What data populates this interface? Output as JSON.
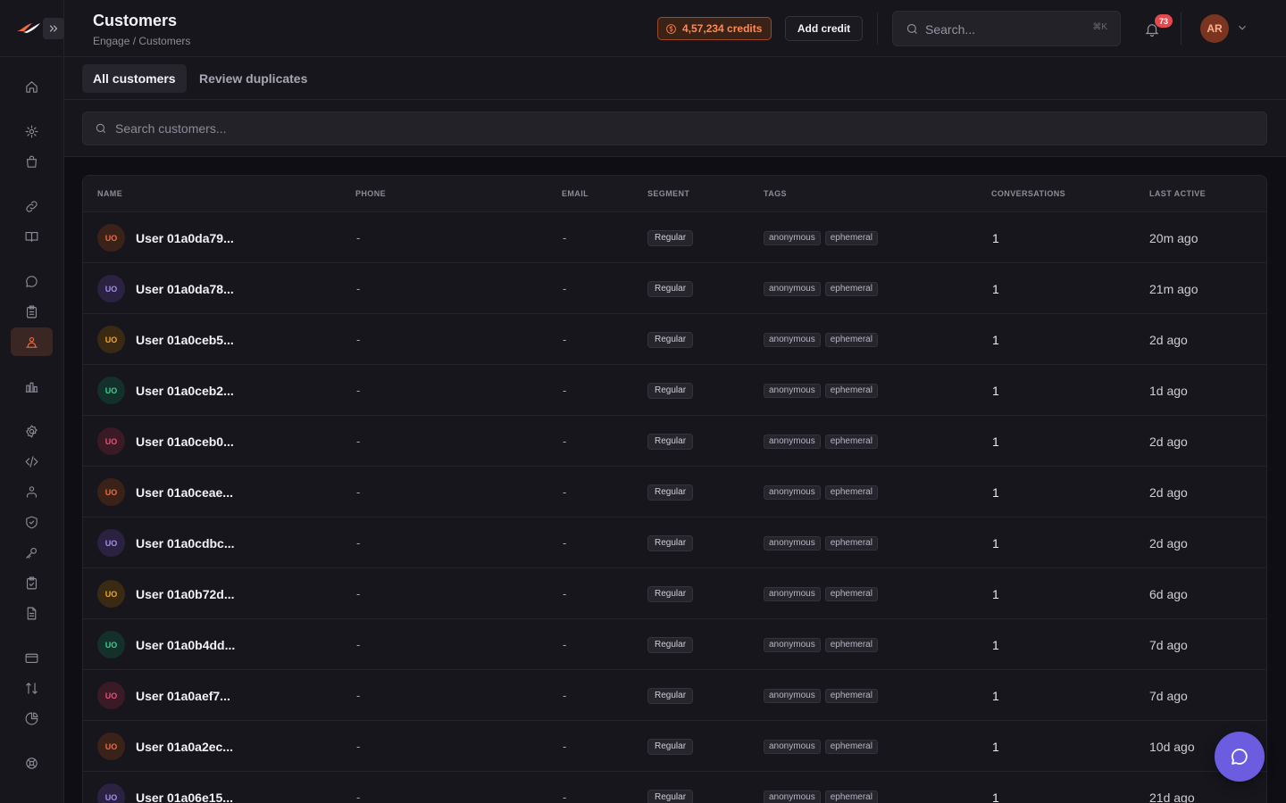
{
  "header": {
    "title": "Customers",
    "breadcrumb": "Engage / Customers",
    "credits_label": "4,57,234 credits",
    "add_credit_label": "Add credit",
    "search_placeholder": "Search...",
    "search_shortcut": "⌘K",
    "notification_count": "73",
    "user_initials": "AR"
  },
  "tabs": [
    {
      "label": "All customers",
      "active": true
    },
    {
      "label": "Review duplicates",
      "active": false
    }
  ],
  "customer_search": {
    "placeholder": "Search customers..."
  },
  "table": {
    "columns": [
      "NAME",
      "PHONE",
      "EMAIL",
      "SEGMENT",
      "TAGS",
      "CONVERSATIONS",
      "LAST ACTIVE"
    ],
    "rows": [
      {
        "initials": "UO",
        "name": "User 01a0da79...",
        "phone": "-",
        "email": "-",
        "segment": "Regular",
        "tags": [
          "anonymous",
          "ephemeral"
        ],
        "conversations": "1",
        "last_active": "20m ago"
      },
      {
        "initials": "UO",
        "name": "User 01a0da78...",
        "phone": "-",
        "email": "-",
        "segment": "Regular",
        "tags": [
          "anonymous",
          "ephemeral"
        ],
        "conversations": "1",
        "last_active": "21m ago"
      },
      {
        "initials": "UO",
        "name": "User 01a0ceb5...",
        "phone": "-",
        "email": "-",
        "segment": "Regular",
        "tags": [
          "anonymous",
          "ephemeral"
        ],
        "conversations": "1",
        "last_active": "2d ago"
      },
      {
        "initials": "UO",
        "name": "User 01a0ceb2...",
        "phone": "-",
        "email": "-",
        "segment": "Regular",
        "tags": [
          "anonymous",
          "ephemeral"
        ],
        "conversations": "1",
        "last_active": "1d ago"
      },
      {
        "initials": "UO",
        "name": "User 01a0ceb0...",
        "phone": "-",
        "email": "-",
        "segment": "Regular",
        "tags": [
          "anonymous",
          "ephemeral"
        ],
        "conversations": "1",
        "last_active": "2d ago"
      },
      {
        "initials": "UO",
        "name": "User 01a0ceae...",
        "phone": "-",
        "email": "-",
        "segment": "Regular",
        "tags": [
          "anonymous",
          "ephemeral"
        ],
        "conversations": "1",
        "last_active": "2d ago"
      },
      {
        "initials": "UO",
        "name": "User 01a0cdbc...",
        "phone": "-",
        "email": "-",
        "segment": "Regular",
        "tags": [
          "anonymous",
          "ephemeral"
        ],
        "conversations": "1",
        "last_active": "2d ago"
      },
      {
        "initials": "UO",
        "name": "User 01a0b72d...",
        "phone": "-",
        "email": "-",
        "segment": "Regular",
        "tags": [
          "anonymous",
          "ephemeral"
        ],
        "conversations": "1",
        "last_active": "6d ago"
      },
      {
        "initials": "UO",
        "name": "User 01a0b4dd...",
        "phone": "-",
        "email": "-",
        "segment": "Regular",
        "tags": [
          "anonymous",
          "ephemeral"
        ],
        "conversations": "1",
        "last_active": "7d ago"
      },
      {
        "initials": "UO",
        "name": "User 01a0aef7...",
        "phone": "-",
        "email": "-",
        "segment": "Regular",
        "tags": [
          "anonymous",
          "ephemeral"
        ],
        "conversations": "1",
        "last_active": "7d ago"
      },
      {
        "initials": "UO",
        "name": "User 01a0a2ec...",
        "phone": "-",
        "email": "-",
        "segment": "Regular",
        "tags": [
          "anonymous",
          "ephemeral"
        ],
        "conversations": "1",
        "last_active": "10d ago"
      },
      {
        "initials": "UO",
        "name": "User 01a06e15...",
        "phone": "-",
        "email": "-",
        "segment": "Regular",
        "tags": [
          "anonymous",
          "ephemeral"
        ],
        "conversations": "1",
        "last_active": "21d ago"
      }
    ]
  },
  "sidebar": {
    "items": [
      {
        "icon": "home-icon"
      },
      {
        "icon": "cog-icon"
      },
      {
        "icon": "bag-icon"
      },
      {
        "icon": "link-icon"
      },
      {
        "icon": "book-icon"
      },
      {
        "icon": "chat-icon"
      },
      {
        "icon": "clipboard-icon"
      },
      {
        "icon": "users-icon",
        "active": true
      },
      {
        "icon": "bar-chart-icon"
      },
      {
        "icon": "settings-icon"
      },
      {
        "icon": "code-icon"
      },
      {
        "icon": "team-icon"
      },
      {
        "icon": "shield-icon"
      },
      {
        "icon": "key-icon"
      },
      {
        "icon": "clipboard-check-icon"
      },
      {
        "icon": "document-icon"
      },
      {
        "icon": "card-icon"
      },
      {
        "icon": "arrows-icon"
      },
      {
        "icon": "pie-icon"
      },
      {
        "icon": "lifebuoy-icon"
      }
    ]
  },
  "colors": {
    "accent": "#f26a3d",
    "avatar_palettes": [
      {
        "bg": "#3a2218",
        "fg": "#f26a3d"
      },
      {
        "bg": "#2a2240",
        "fg": "#a58cf5"
      },
      {
        "bg": "#3a2a14",
        "fg": "#f5a623"
      },
      {
        "bg": "#13302a",
        "fg": "#3ccf91"
      },
      {
        "bg": "#3a1a24",
        "fg": "#ef4e7a"
      }
    ]
  }
}
